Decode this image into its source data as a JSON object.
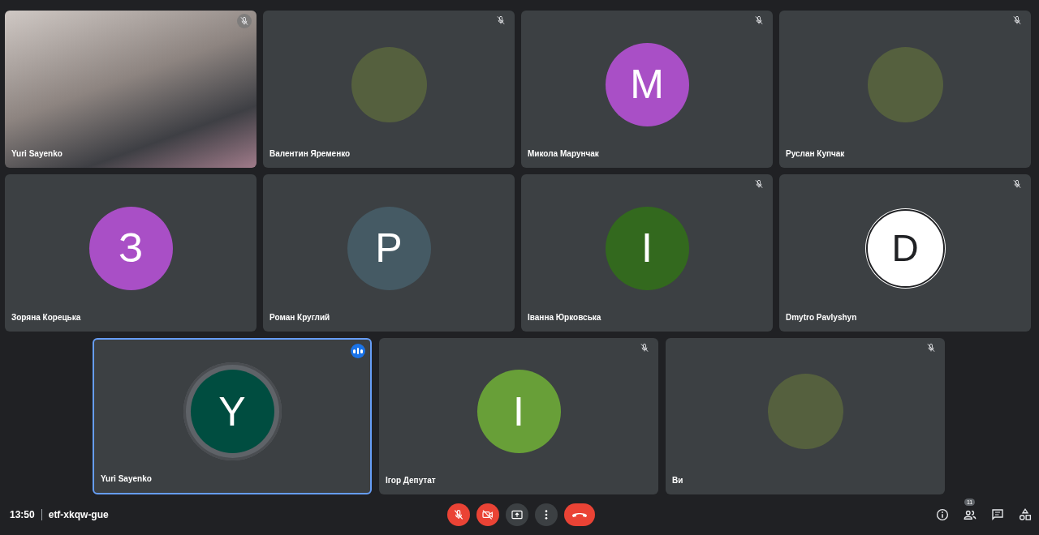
{
  "tile_rows": [
    {
      "tiles": [
        {
          "name": "Yuri Sayenko",
          "kind": "video",
          "muted": true,
          "speaking": false
        },
        {
          "name": "Валентин Яременко",
          "kind": "photo",
          "muted": true,
          "speaking": false
        },
        {
          "name": "Микола Марунчак",
          "kind": "letter",
          "letter": "M",
          "color": "#a94fc6",
          "muted": true,
          "speaking": false
        },
        {
          "name": "Руслан Купчак",
          "kind": "photo",
          "muted": true,
          "speaking": false
        }
      ]
    },
    {
      "tiles": [
        {
          "name": "Зоряна Корецька",
          "kind": "letter",
          "letter": "З",
          "color": "#a94fc6",
          "muted": false,
          "speaking": false
        },
        {
          "name": "Роман Круглий",
          "kind": "letter",
          "letter": "P",
          "color": "#455a64",
          "muted": false,
          "speaking": false
        },
        {
          "name": "Іванна Юрковська",
          "kind": "letter",
          "letter": "I",
          "color": "#33691e",
          "muted": true,
          "speaking": false
        },
        {
          "name": "Dmytro Pavlyshyn",
          "kind": "outline",
          "letter": "D",
          "muted": true,
          "speaking": false
        }
      ]
    },
    {
      "tiles": [
        {
          "name": "Yuri Sayenko",
          "kind": "letter",
          "letter": "Y",
          "color": "#004d40",
          "muted": false,
          "speaking": true
        },
        {
          "name": "Ігор Депутат",
          "kind": "letter",
          "letter": "I",
          "color": "#689f38",
          "muted": true,
          "speaking": false
        },
        {
          "name": "Ви",
          "kind": "photo",
          "muted": true,
          "speaking": false
        }
      ]
    }
  ],
  "bottom_bar": {
    "time": "13:50",
    "meeting_code": "etf-xkqw-gue",
    "participant_count": "11"
  }
}
